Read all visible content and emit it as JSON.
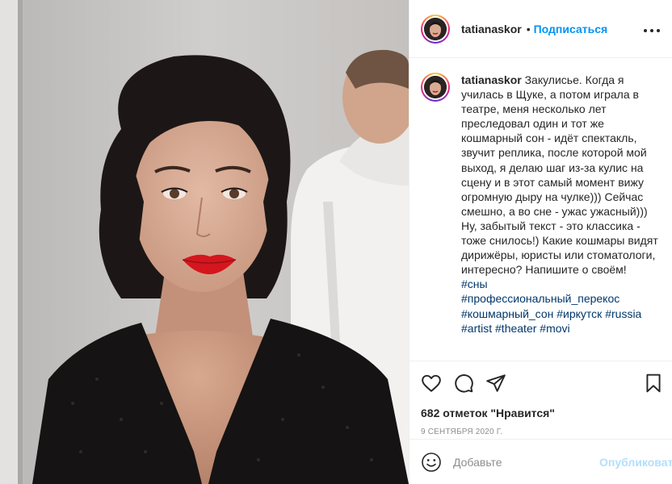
{
  "photo": {
    "alt": "selfie photo"
  },
  "header": {
    "username": "tatianaskor",
    "separator": "•",
    "follow_label": "Подписаться",
    "more_label": "•••"
  },
  "caption": {
    "username": "tatianaskor",
    "text": "Закулисье. Когда я училась в Щуке, а потом играла в театре, меня несколько лет преследовал один и тот же кошмарный сон - идёт спектакль, звучит реплика, после которой мой выход, я делаю шаг из-за кулис на сцену и в этот самый момент вижу огромную дыру на чулке))) Сейчас смешно, а во сне - ужас ужасный))) Ну, забытый текст - это классика - тоже снилось!) Какие кошмары видят дирижёры, юристы или стоматологи, интересно? Напишите о своём!",
    "tags": [
      "#сны",
      "#профессиональный_перекос",
      "#кошмарный_сон",
      "#иркутск",
      "#russia",
      "#artist",
      "#theater",
      "#movi"
    ]
  },
  "actions": {
    "like_icon": "heart-icon",
    "comment_icon": "comment-icon",
    "share_icon": "paper-plane-icon",
    "save_icon": "bookmark-icon"
  },
  "likes_text": "682 отметок \"Нравится\"",
  "date_text": "9 сентября 2020 г.",
  "comment_box": {
    "placeholder": "Добавьте",
    "post_label": "Опубликовать",
    "emoji_icon": "smiley-icon"
  },
  "colors": {
    "link_blue": "#0095f6",
    "hashtag": "#00376b",
    "muted": "#8e8e8e",
    "post_disabled": "#b2dffc"
  }
}
